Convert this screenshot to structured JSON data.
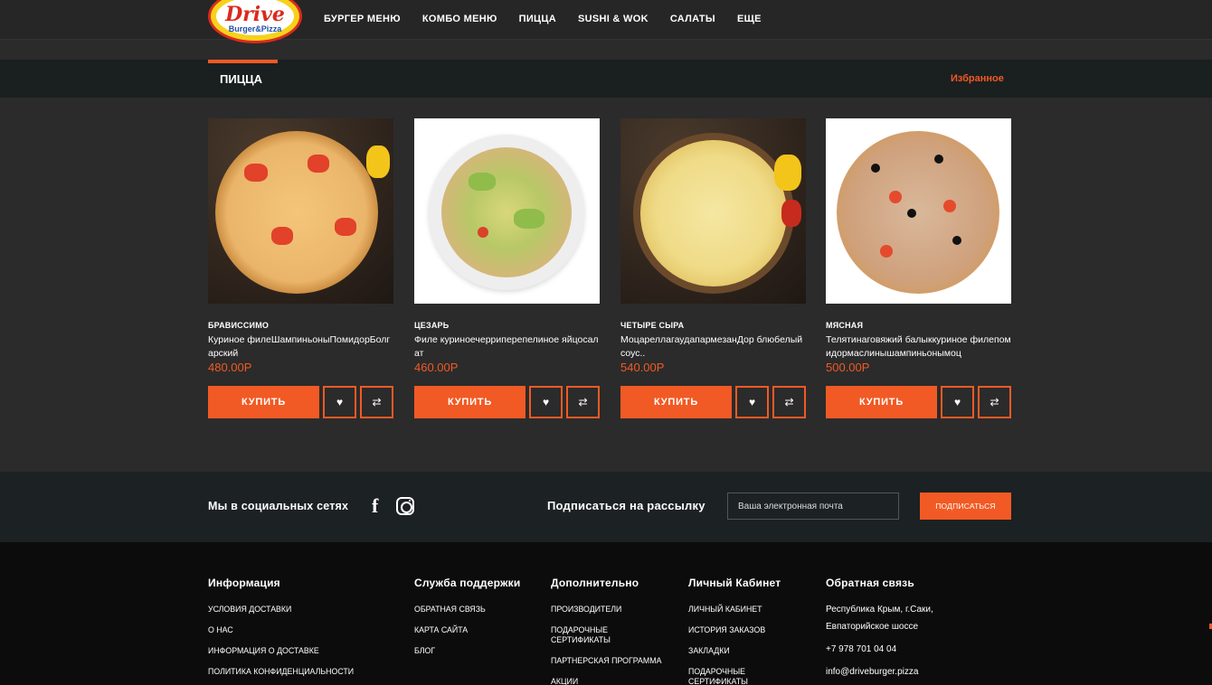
{
  "header": {
    "logo": {
      "title": "Drive",
      "subtitle": "Burger&Pizza"
    },
    "nav": [
      "БУРГЕР МЕНЮ",
      "КОМБО МЕНЮ",
      "ПИЦЦА",
      "SUSHI & WOK",
      "САЛАТЫ",
      "ЕЩЕ"
    ]
  },
  "category": {
    "title": "ПИЦЦА",
    "favorites_link": "Избранное"
  },
  "products": [
    {
      "name": "БРАВИССИМО",
      "description": "Куриное филеШампиньоныПомидорБолгарский",
      "price": "480.00Р",
      "buy_label": "КУПИТЬ"
    },
    {
      "name": "ЦЕЗАРЬ",
      "description": "Филе куриноечерриперепелиное яйцосалат",
      "price": "460.00Р",
      "buy_label": "КУПИТЬ"
    },
    {
      "name": "ЧЕТЫРЕ СЫРА",
      "description": "МоцареллагаудапармезанДор блюбелый соус..",
      "price": "540.00Р",
      "buy_label": "КУПИТЬ"
    },
    {
      "name": "МЯСНАЯ",
      "description": "Телятинаговяжий балыккуриное филепомидормаслинышампиньонымоц",
      "price": "500.00Р",
      "buy_label": "КУПИТЬ"
    }
  ],
  "social": {
    "label": "Мы в социальных сетях",
    "facebook_glyph": "f",
    "subscribe_label": "Подписаться на рассылку",
    "email_placeholder": "Ваша электронная почта",
    "subscribe_button": "ПОДПИСАТЬСЯ"
  },
  "footer": {
    "info": {
      "title": "Информация",
      "links": [
        "УСЛОВИЯ ДОСТАВКИ",
        "О НАС",
        "ИНФОРМАЦИЯ О ДОСТАВКЕ",
        "ПОЛИТИКА КОНФИДЕНЦИАЛЬНОСТИ"
      ]
    },
    "support": {
      "title": "Служба поддержки",
      "links": [
        "ОБРАТНАЯ СВЯЗЬ",
        "КАРТА САЙТА",
        "БЛОГ"
      ]
    },
    "extra": {
      "title": "Дополнительно",
      "links": [
        "ПРОИЗВОДИТЕЛИ",
        "ПОДАРОЧНЫЕ СЕРТИФИКАТЫ",
        "ПАРТНЕРСКАЯ ПРОГРАММА",
        "АКЦИИ"
      ]
    },
    "account": {
      "title": "Личный Кабинет",
      "links": [
        "ЛИЧНЫЙ КАБИНЕТ",
        "ИСТОРИЯ ЗАКАЗОВ",
        "ЗАКЛАДКИ",
        "ПОДАРОЧНЫЕ СЕРТИФИКАТЫ"
      ]
    },
    "contact": {
      "title": "Обратная связь",
      "address": "Республика Крым, г.Саки, Евпаторийское шоссе",
      "phone": "+7 978 701 04 04",
      "email": "info@driveburger.pizza"
    }
  },
  "colors": {
    "accent": "#f15a24",
    "background": "#2b2b2b",
    "footer": "#0c0c0c"
  }
}
